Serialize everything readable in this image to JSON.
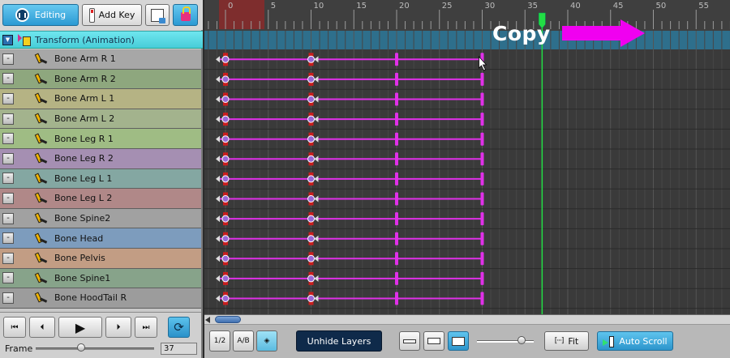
{
  "toolbar": {
    "editing_label": "Editing",
    "add_key_label": "Add Key"
  },
  "group": {
    "label": "Transform (Animation)",
    "color": "#5ad8e2"
  },
  "layers": [
    {
      "label": "Bone Arm R 1",
      "color": "#a7a7a7"
    },
    {
      "label": "Bone Arm R 2",
      "color": "#8ea77e"
    },
    {
      "label": "Bone Arm L 1",
      "color": "#b5b384"
    },
    {
      "label": "Bone Arm L 2",
      "color": "#a3b38d"
    },
    {
      "label": "Bone Leg R 1",
      "color": "#9fbc84"
    },
    {
      "label": "Bone Leg R 2",
      "color": "#a58fb2"
    },
    {
      "label": "Bone Leg L 1",
      "color": "#84a7a2"
    },
    {
      "label": "Bone Leg L 2",
      "color": "#b08888"
    },
    {
      "label": "Bone Spine2",
      "color": "#a1a1a1"
    },
    {
      "label": "Bone Head",
      "color": "#7d9cbd"
    },
    {
      "label": "Bone Pelvis",
      "color": "#c29d84"
    },
    {
      "label": "Bone Spine1",
      "color": "#87a38a"
    },
    {
      "label": "Bone HoodTail R",
      "color": "#9c9c9c"
    }
  ],
  "transport": {
    "frame_label": "Frame",
    "frame_value": "37",
    "first_glyph": "⏮",
    "prev_glyph": "⏴",
    "play_glyph": "▶",
    "next_glyph": "⏵",
    "last_glyph": "⏭",
    "loop_glyph": "⟳"
  },
  "timeline": {
    "ticks": [
      "0",
      "5",
      "10",
      "15",
      "20",
      "25",
      "30",
      "35",
      "40",
      "45",
      "50",
      "55"
    ],
    "current_frame": 37,
    "keyframes": [
      0,
      10,
      20,
      30
    ],
    "overlay_text": "Copy",
    "key_color": "#e030e8",
    "playhead_color": "#22dd44"
  },
  "bottom": {
    "unhide_label": "Unhide Layers",
    "fit_label": "Fit",
    "fit_icon": "[···]",
    "autoscroll_label": "Auto Scroll",
    "mini1": "1/2",
    "mini2": "A/B"
  }
}
